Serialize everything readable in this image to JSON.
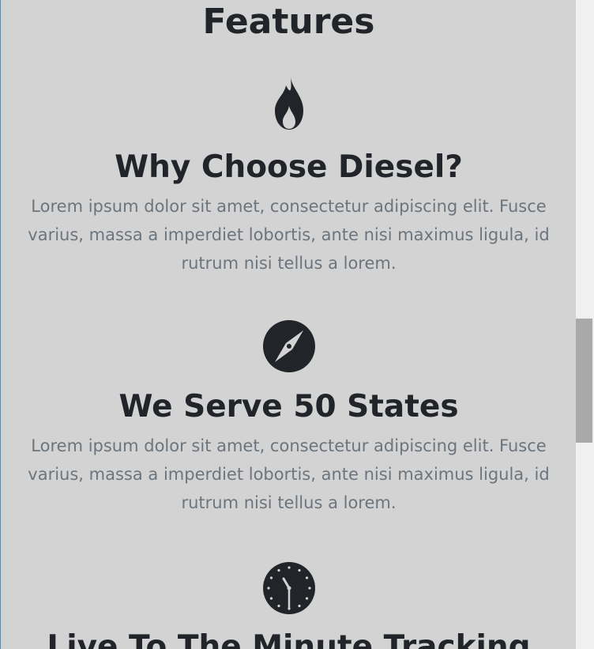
{
  "section": {
    "title": "Features"
  },
  "features": [
    {
      "icon": "flame-icon",
      "title": "Why Choose Diesel?",
      "text": "Lorem ipsum dolor sit amet, consectetur adipiscing elit. Fusce varius, massa a imperdiet lobortis, ante nisi maximus ligula, id rutrum nisi tellus a lorem."
    },
    {
      "icon": "compass-icon",
      "title": "We Serve 50 States",
      "text": "Lorem ipsum dolor sit amet, consectetur adipiscing elit. Fusce varius, massa a imperdiet lobortis, ante nisi maximus ligula, id rutrum nisi tellus a lorem."
    },
    {
      "icon": "clock-icon",
      "title": "Live To The Minute Tracking"
    }
  ],
  "colors": {
    "background": "#d3d3d3",
    "heading": "#212529",
    "body_text": "#6c757d",
    "icon": "#212529"
  }
}
